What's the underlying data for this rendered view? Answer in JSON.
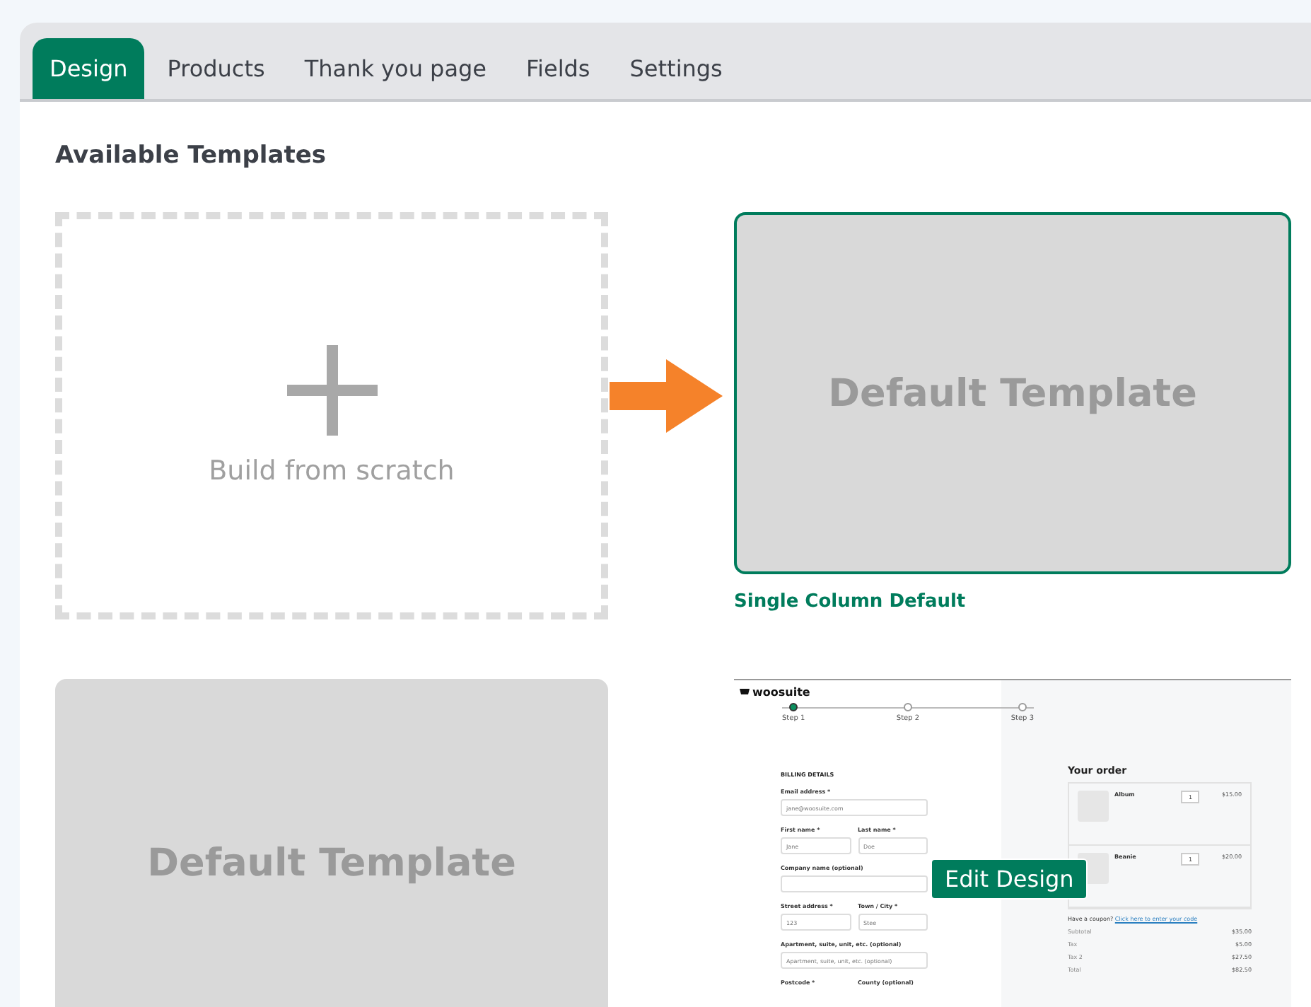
{
  "tabs": [
    {
      "label": "Design",
      "selected": true
    },
    {
      "label": "Products",
      "selected": false
    },
    {
      "label": "Thank you page",
      "selected": false
    },
    {
      "label": "Fields",
      "selected": false
    },
    {
      "label": "Settings",
      "selected": false
    }
  ],
  "section_title": "Available Templates",
  "templates": [
    {
      "kind": "scratch",
      "label": "Build from scratch"
    },
    {
      "kind": "placeholder",
      "preview_text": "Default Template",
      "caption": "Single Column Default",
      "selected": true
    },
    {
      "kind": "placeholder",
      "preview_text": "Default Template",
      "selected": false
    },
    {
      "kind": "checkout",
      "selected": false,
      "edit_button": "Edit Design",
      "preview": {
        "logo": "woosuite",
        "steps": [
          {
            "label": "Step 1",
            "selected": true
          },
          {
            "label": "Step 2",
            "selected": false
          },
          {
            "label": "Step 3",
            "selected": false
          }
        ],
        "billing_title": "BILLING DETAILS",
        "field_rows": [
          [
            {
              "label": "Email address *",
              "value": "jane@woosuite.com"
            }
          ],
          [
            {
              "label": "First name *",
              "value": "Jane"
            },
            {
              "label": "Last name *",
              "value": "Doe"
            }
          ],
          [
            {
              "label": "Company name (optional)"
            }
          ],
          [
            {
              "label": "Street address *",
              "value": "123"
            },
            {
              "label": "Town / City *",
              "value": "Stee"
            }
          ],
          [
            {
              "label": "Apartment, suite, unit, etc. (optional)",
              "placeholder": "Apartment, suite, unit, etc. (optional)"
            }
          ],
          [
            {
              "label": "Postcode *"
            },
            {
              "label": "County (optional)"
            }
          ]
        ],
        "order_title": "Your order",
        "items": [
          {
            "name": "Album",
            "qty": "1",
            "price": "$15.00"
          },
          {
            "name": "Beanie",
            "qty": "1",
            "price": "$20.00"
          }
        ],
        "coupon_text": "Have a coupon?",
        "coupon_link": "Click here to enter your code",
        "totals": [
          {
            "label": "Subtotal",
            "value": "$35.00"
          },
          {
            "label": "Tax",
            "value": "$5.00"
          },
          {
            "label": "Tax 2",
            "value": "$27.50"
          },
          {
            "label": "Total",
            "value": "$82.50"
          }
        ]
      }
    }
  ]
}
